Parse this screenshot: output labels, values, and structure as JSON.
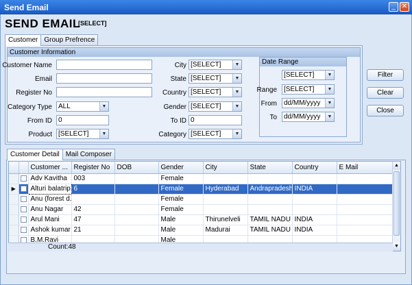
{
  "window": {
    "title": "Send Email"
  },
  "header": {
    "title": "SEND EMAIL",
    "subtitle": "[SELECT]"
  },
  "top_tabs": [
    "Customer",
    "Group Prefrence"
  ],
  "customer_info": {
    "title": "Customer Information",
    "customer_name_label": "Customer Name",
    "email_label": "Email",
    "register_no_label": "Register No",
    "category_type_label": "Category Type",
    "category_type_value": "ALL",
    "from_id_label": "From ID",
    "from_id_value": "0",
    "product_label": "Product",
    "product_value": "[SELECT]",
    "city_label": "City",
    "city_value": "[SELECT]",
    "state_label": "State",
    "state_value": "[SELECT]",
    "country_label": "Country",
    "country_value": "[SELECT]",
    "gender_label": "Gender",
    "gender_value": "[SELECT]",
    "to_id_label": "To ID",
    "to_id_value": "0",
    "category_label": "Category",
    "category_value": "[SELECT]"
  },
  "date_range": {
    "title": "Date Range",
    "select_value": "[SELECT]",
    "range_label": "Range",
    "range_value": "[SELECT]",
    "from_label": "From",
    "from_value": "dd/MM/yyyy",
    "to_label": "To",
    "to_value": "dd/MM/yyyy"
  },
  "buttons": {
    "filter": "Filter",
    "clear": "Clear",
    "close": "Close"
  },
  "bottom_tabs": [
    "Customer Detail",
    "Mail Composer"
  ],
  "grid": {
    "columns": [
      "Customer ...",
      "Register No",
      "DOB",
      "Gender",
      "City",
      "State",
      "Country",
      "E Mail"
    ],
    "rows": [
      {
        "name": "Adv Kavitha",
        "reg": "003",
        "dob": "",
        "gender": "Female",
        "city": "",
        "state": "",
        "country": "",
        "email": ""
      },
      {
        "name": "Alturi balatrip...",
        "reg": "6",
        "dob": "",
        "gender": "Female",
        "city": "Hyderabad",
        "state": "Andrapradesh",
        "country": "INDIA",
        "email": ""
      },
      {
        "name": "Anu  (forest d...",
        "reg": "",
        "dob": "",
        "gender": "Female",
        "city": "",
        "state": "",
        "country": "",
        "email": ""
      },
      {
        "name": "Anu Nagar",
        "reg": "42",
        "dob": "",
        "gender": "Female",
        "city": "",
        "state": "",
        "country": "",
        "email": ""
      },
      {
        "name": "Arul Mani",
        "reg": "47",
        "dob": "",
        "gender": "Male",
        "city": "Thirunelveli",
        "state": "TAMIL NADU",
        "country": "INDIA",
        "email": ""
      },
      {
        "name": "Ashok  kumar",
        "reg": "21",
        "dob": "",
        "gender": "Male",
        "city": "Madurai",
        "state": "TAMIL NADU",
        "country": "INDIA",
        "email": ""
      },
      {
        "name": "B.M.Ravi",
        "reg": "",
        "dob": "",
        "gender": "Male",
        "city": "",
        "state": "",
        "country": "",
        "email": ""
      }
    ],
    "selected_row": 1,
    "count_label": "Count:48"
  }
}
